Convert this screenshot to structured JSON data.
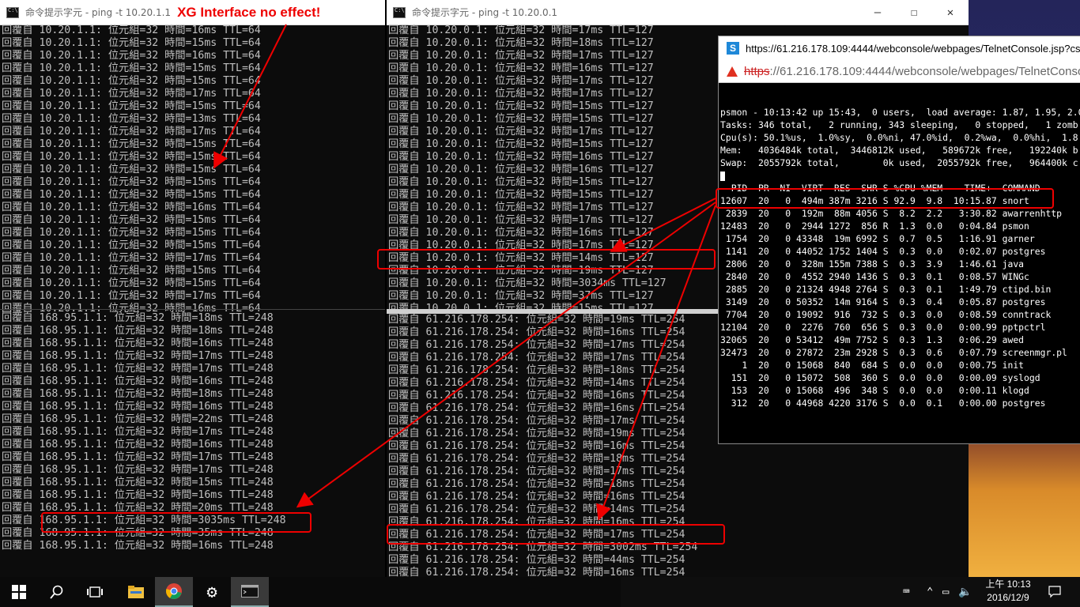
{
  "window_left": {
    "title": "命令提示字元 - ping  -t 10.20.1.1",
    "note": "XG Interface no effect!",
    "lines_top": [
      "回覆自 10.20.1.1: 位元組=32 時間=16ms TTL=64",
      "回覆自 10.20.1.1: 位元組=32 時間=15ms TTL=64",
      "回覆自 10.20.1.1: 位元組=32 時間=16ms TTL=64",
      "回覆自 10.20.1.1: 位元組=32 時間=15ms TTL=64",
      "回覆自 10.20.1.1: 位元組=32 時間=15ms TTL=64",
      "回覆自 10.20.1.1: 位元組=32 時間=17ms TTL=64",
      "回覆自 10.20.1.1: 位元組=32 時間=15ms TTL=64",
      "回覆自 10.20.1.1: 位元組=32 時間=13ms TTL=64",
      "回覆自 10.20.1.1: 位元組=32 時間=17ms TTL=64",
      "回覆自 10.20.1.1: 位元組=32 時間=15ms TTL=64",
      "回覆自 10.20.1.1: 位元組=32 時間=15ms TTL=64",
      "回覆自 10.20.1.1: 位元組=32 時間=15ms TTL=64",
      "回覆自 10.20.1.1: 位元組=32 時間=15ms TTL=64",
      "回覆自 10.20.1.1: 位元組=32 時間=15ms TTL=64",
      "回覆自 10.20.1.1: 位元組=32 時間=16ms TTL=64",
      "回覆自 10.20.1.1: 位元組=32 時間=15ms TTL=64",
      "回覆自 10.20.1.1: 位元組=32 時間=15ms TTL=64",
      "回覆自 10.20.1.1: 位元組=32 時間=15ms TTL=64",
      "回覆自 10.20.1.1: 位元組=32 時間=17ms TTL=64",
      "回覆自 10.20.1.1: 位元組=32 時間=15ms TTL=64",
      "回覆自 10.20.1.1: 位元組=32 時間=15ms TTL=64",
      "回覆自 10.20.1.1: 位元組=32 時間=17ms TTL=64",
      "回覆自 10.20.1.1: 位元組=32 時間=16ms TTL=64"
    ],
    "lines_bottom": [
      "回覆自 168.95.1.1: 位元組=32 時間=18ms TTL=248",
      "回覆自 168.95.1.1: 位元組=32 時間=18ms TTL=248",
      "回覆自 168.95.1.1: 位元組=32 時間=16ms TTL=248",
      "回覆自 168.95.1.1: 位元組=32 時間=17ms TTL=248",
      "回覆自 168.95.1.1: 位元組=32 時間=17ms TTL=248",
      "回覆自 168.95.1.1: 位元組=32 時間=16ms TTL=248",
      "回覆自 168.95.1.1: 位元組=32 時間=18ms TTL=248",
      "回覆自 168.95.1.1: 位元組=32 時間=16ms TTL=248",
      "回覆自 168.95.1.1: 位元組=32 時間=22ms TTL=248",
      "回覆自 168.95.1.1: 位元組=32 時間=17ms TTL=248",
      "回覆自 168.95.1.1: 位元組=32 時間=16ms TTL=248",
      "回覆自 168.95.1.1: 位元組=32 時間=17ms TTL=248",
      "回覆自 168.95.1.1: 位元組=32 時間=17ms TTL=248",
      "回覆自 168.95.1.1: 位元組=32 時間=15ms TTL=248",
      "回覆自 168.95.1.1: 位元組=32 時間=16ms TTL=248",
      "回覆自 168.95.1.1: 位元組=32 時間=20ms TTL=248",
      "回覆自 168.95.1.1: 位元組=32 時間=3035ms TTL=248",
      "回覆自 168.95.1.1: 位元組=32 時間=35ms TTL=248",
      "回覆自 168.95.1.1: 位元組=32 時間=16ms TTL=248"
    ]
  },
  "window_right": {
    "title": "命令提示字元 - ping  -t 10.20.0.1",
    "minimize_label": "—",
    "maximize_label": "☐",
    "close_label": "✕",
    "lines_top": [
      "回覆自 10.20.0.1: 位元組=32 時間=17ms TTL=127",
      "回覆自 10.20.0.1: 位元組=32 時間=18ms TTL=127",
      "回覆自 10.20.0.1: 位元組=32 時間=17ms TTL=127",
      "回覆自 10.20.0.1: 位元組=32 時間=16ms TTL=127",
      "回覆自 10.20.0.1: 位元組=32 時間=17ms TTL=127",
      "回覆自 10.20.0.1: 位元組=32 時間=17ms TTL=127",
      "回覆自 10.20.0.1: 位元組=32 時間=15ms TTL=127",
      "回覆自 10.20.0.1: 位元組=32 時間=15ms TTL=127",
      "回覆自 10.20.0.1: 位元組=32 時間=17ms TTL=127",
      "回覆自 10.20.0.1: 位元組=32 時間=15ms TTL=127",
      "回覆自 10.20.0.1: 位元組=32 時間=16ms TTL=127",
      "回覆自 10.20.0.1: 位元組=32 時間=16ms TTL=127",
      "回覆自 10.20.0.1: 位元組=32 時間=15ms TTL=127",
      "回覆自 10.20.0.1: 位元組=32 時間=15ms TTL=127",
      "回覆自 10.20.0.1: 位元組=32 時間=17ms TTL=127",
      "回覆自 10.20.0.1: 位元組=32 時間=17ms TTL=127",
      "回覆自 10.20.0.1: 位元組=32 時間=16ms TTL=127",
      "回覆自 10.20.0.1: 位元組=32 時間=17ms TTL=127",
      "回覆自 10.20.0.1: 位元組=32 時間=14ms TTL=127",
      "回覆自 10.20.0.1: 位元組=32 時間=19ms TTL=127",
      "回覆自 10.20.0.1: 位元組=32 時間=3034ms TTL=127",
      "回覆自 10.20.0.1: 位元組=32 時間=37ms TTL=127",
      "回覆自 10.20.0.1: 位元組=32 時間=15ms TTL=127"
    ],
    "lines_bottom": [
      "回覆自 61.216.178.254: 位元組=32 時間=19ms TTL=254",
      "回覆自 61.216.178.254: 位元組=32 時間=16ms TTL=254",
      "回覆自 61.216.178.254: 位元組=32 時間=17ms TTL=254",
      "回覆自 61.216.178.254: 位元組=32 時間=17ms TTL=254",
      "回覆自 61.216.178.254: 位元組=32 時間=18ms TTL=254",
      "回覆自 61.216.178.254: 位元組=32 時間=14ms TTL=254",
      "回覆自 61.216.178.254: 位元組=32 時間=16ms TTL=254",
      "回覆自 61.216.178.254: 位元組=32 時間=16ms TTL=254",
      "回覆自 61.216.178.254: 位元組=32 時間=17ms TTL=254",
      "回覆自 61.216.178.254: 位元組=32 時間=19ms TTL=254",
      "回覆自 61.216.178.254: 位元組=32 時間=16ms TTL=254",
      "回覆自 61.216.178.254: 位元組=32 時間=18ms TTL=254",
      "回覆自 61.216.178.254: 位元組=32 時間=17ms TTL=254",
      "回覆自 61.216.178.254: 位元組=32 時間=18ms TTL=254",
      "回覆自 61.216.178.254: 位元組=32 時間=16ms TTL=254",
      "回覆自 61.216.178.254: 位元組=32 時間=14ms TTL=254",
      "回覆自 61.216.178.254: 位元組=32 時間=16ms TTL=254",
      "回覆自 61.216.178.254: 位元組=32 時間=17ms TTL=254",
      "回覆自 61.216.178.254: 位元組=32 時間=3002ms TTL=254",
      "回覆自 61.216.178.254: 位元組=32 時間=44ms TTL=254",
      "回覆自 61.216.178.254: 位元組=32 時間=16ms TTL=254"
    ]
  },
  "browser": {
    "title_url": "https://61.216.178.109:4444/webconsole/webpages/TelnetConsole.jsp?csrf",
    "address_scheme": "https",
    "address_rest": "://61.216.178.109:4444/webconsole/webpages/TelnetConsole.jsp",
    "site_icon_letter": "S",
    "terminal_lines": [
      "psmon - 10:13:42 up 15:43,  0 users,  load average: 1.87, 1.95, 2.0",
      "Tasks: 346 total,   2 running, 343 sleeping,   0 stopped,   1 zomb",
      "Cpu(s): 50.1%us,  1.0%sy,  0.0%ni, 47.0%id,  0.2%wa,  0.0%hi,  1.8",
      "Mem:   4036484k total,  3446812k used,   589672k free,   192240k b",
      "Swap:  2055792k total,        0k used,  2055792k free,   964400k c",
      "",
      "  PID  PR  NI  VIRT  RES  SHR S %CPU %MEM    TIME+  COMMAND",
      "12607  20   0  494m 387m 3216 S 92.9  9.8  10:15.87 snort",
      " 2839  20   0  192m  88m 4056 S  8.2  2.2   3:30.82 awarrenhttp",
      "12483  20   0  2944 1272  856 R  1.3  0.0   0:04.84 psmon",
      " 1754  20   0 43348  19m 6992 S  0.7  0.5   1:16.91 garner",
      " 1141  20   0 44052 1752 1404 S  0.3  0.0   0:02.07 postgres",
      " 2806  20   0  328m 155m 7388 S  0.3  3.9   1:46.61 java",
      " 2840  20   0  4552 2940 1436 S  0.3  0.1   0:08.57 WINGc",
      " 2885  20   0 21324 4948 2764 S  0.3  0.1   1:49.79 ctipd.bin",
      " 3149  20   0 50352  14m 9164 S  0.3  0.4   0:05.87 postgres",
      " 7704  20   0 19092  916  732 S  0.3  0.0   0:08.59 conntrack",
      "12104  20   0  2276  760  656 S  0.3  0.0   0:00.99 pptpctrl",
      "32065  20   0 53412  49m 7752 S  0.3  1.3   0:06.29 awed",
      "32473  20   0 27872  23m 2928 S  0.3  0.6   0:07.79 screenmgr.pl",
      "    1  20   0 15068  840  684 S  0.0  0.0   0:00.75 init",
      "  151  20   0 15072  508  360 S  0.0  0.0   0:00.09 syslogd",
      "  153  20   0 15068  496  348 S  0.0  0.0   0:00.11 klogd",
      "  312  20   0 44968 4220 3176 S  0.0  0.1   0:00.00 postgres"
    ]
  },
  "taskbar": {
    "clock_time": "上午 10:13",
    "clock_date": "2016/12/9",
    "notification_icon": "speech-bubble-icon"
  },
  "colors": {
    "annotation": "#e00000",
    "console_text": "#c0c0c0",
    "console_bg": "#0c0c0c"
  }
}
